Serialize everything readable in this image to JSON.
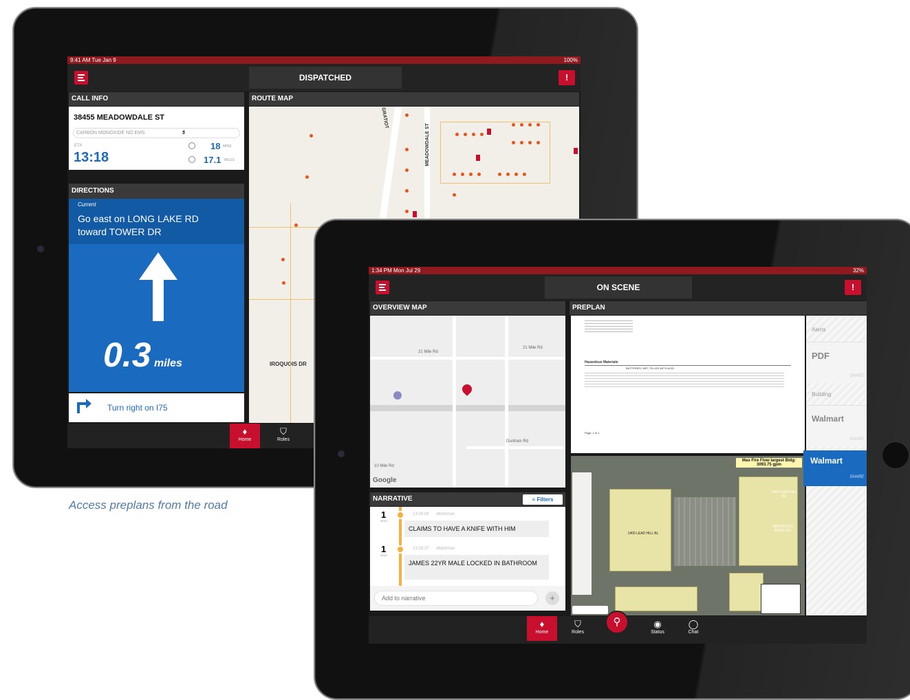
{
  "caption": "Access preplans from the road",
  "ipad1": {
    "status": {
      "time": "9:41 AM  Tue Jan 9",
      "battery": "100%"
    },
    "title": "DISPATCHED",
    "call_info": {
      "header": "CALL INFO",
      "address": "38455 MEADOWDALE ST",
      "type": "CARBON MONOXIDE NO EMS",
      "type_count": "5",
      "eta_label": "ETA",
      "eta": "13:18",
      "mins_value": "18",
      "mins_unit": "MINS",
      "miles_value": "17.1",
      "miles_unit": "MILES"
    },
    "route_map": {
      "header": "ROUTE MAP",
      "street1": "S GRATIOT",
      "street2": "MEADOWDALE ST",
      "street3": "IROQUOIS DR"
    },
    "directions": {
      "header": "DIRECTIONS",
      "current_label": "Current",
      "current_text": "Go east on LONG LAKE RD toward TOWER DR",
      "distance": "0.3",
      "distance_unit": "miles",
      "next": "Turn right on I75"
    },
    "tabs": [
      {
        "label": "Home",
        "icon": "flame-icon"
      },
      {
        "label": "Roles",
        "icon": "shield-icon"
      }
    ]
  },
  "ipad2": {
    "status": {
      "time": "1:34 PM  Mon Jul 29",
      "battery": "32%"
    },
    "title": "ON SCENE",
    "overview_map": {
      "header": "OVERVIEW MAP",
      "road1": "21 Mile Rd",
      "road2": "21 Mile Rd",
      "road3": "Dunham Rd",
      "road4": "10 Mile Rd",
      "google": "Google"
    },
    "preplan": {
      "header": "PREPLAN",
      "doc_heading": "Hazardous Materials",
      "doc_line": "BATTERIES, WET, FILLED WITH ACID",
      "page": "Page: 1 of 1",
      "max_fire_flow": "Max Fire Flow largest Bldg: 3093.75 gpm",
      "building1": "1400 LEAD HILL BL",
      "building2": "1400 LEAD HILL BL",
      "building3": "1800 ROCKY RIDGE RD",
      "side": [
        {
          "label": "Alerts",
          "kind": "section"
        },
        {
          "label": "PDF",
          "kind": "item",
          "share": "SHARE"
        },
        {
          "label": "Building",
          "kind": "section"
        },
        {
          "label": "Walmart",
          "kind": "item",
          "share": "SHARE"
        },
        {
          "label": "Walmart",
          "kind": "active",
          "share": "SHARE"
        }
      ]
    },
    "narrative": {
      "header": "NARRATIVE",
      "filters": "Filters",
      "entries": [
        {
          "count": "1",
          "unit": "MINS",
          "time": "13:34:09",
          "user": "dkletzman",
          "text": "CLAIMS TO HAVE A KNIFE WITH HIM"
        },
        {
          "count": "1",
          "unit": "MINS",
          "time": "13:33:37",
          "user": "dkletzman",
          "text": "JAMES 22YR MALE LOCKED IN BATHROOM"
        }
      ],
      "input_placeholder": "Add to narrative"
    },
    "tabs": [
      {
        "label": "Home",
        "icon": "flame-icon"
      },
      {
        "label": "Roles",
        "icon": "shield-icon"
      },
      {
        "label": "",
        "icon": "search-icon"
      },
      {
        "label": "Status",
        "icon": "status-icon"
      },
      {
        "label": "Chat",
        "icon": "chat-icon"
      }
    ]
  },
  "colors": {
    "brand_red": "#c8102e",
    "status_red": "#8e1a1f",
    "blue": "#1a6bbf",
    "dark": "#1a1a1a"
  }
}
